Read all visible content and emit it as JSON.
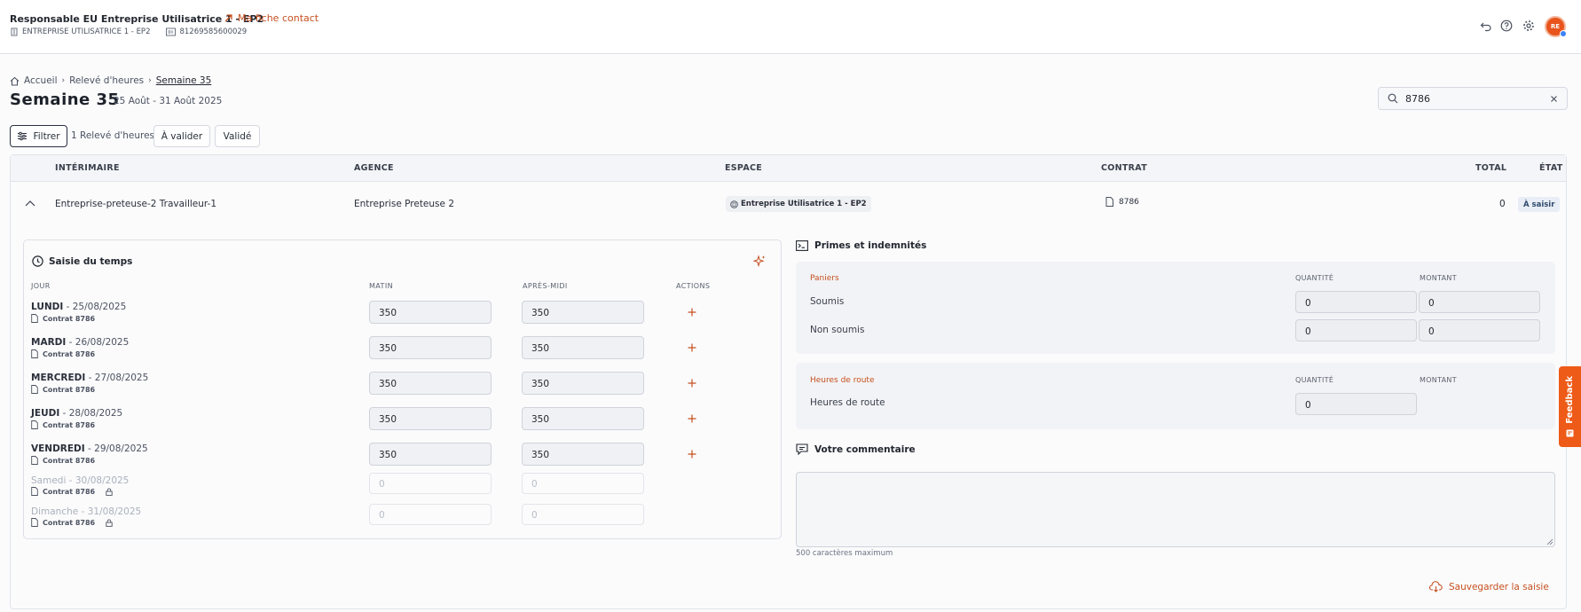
{
  "header": {
    "user_title": "Responsable EU Entreprise Utilisatrice 1 - EP2",
    "contact_link": "Ma fiche contact",
    "company_name": "ENTREPRISE UTILISATRICE 1 - EP2",
    "siret": "81269585600029",
    "avatar_initials": "RE"
  },
  "breadcrumb": {
    "home": "Accueil",
    "releve": "Relevé d'heures",
    "current": "Semaine 35"
  },
  "page": {
    "title": "Semaine 35",
    "dates": "25 Août - 31 Août 2025"
  },
  "search": {
    "value": "8786"
  },
  "toolbar": {
    "filter_label": "Filtrer",
    "count_label": "1 Relevé d'heures",
    "a_valider": "À valider",
    "valide": "Validé"
  },
  "table": {
    "columns": [
      "INTÉRIMAIRE",
      "AGENCE",
      "ESPACE",
      "CONTRAT",
      "TOTAL",
      "ÉTAT"
    ],
    "row": {
      "interimaire": "Entreprise-preteuse-2 Travailleur-1",
      "agence": "Entreprise Preteuse 2",
      "espace": "Entreprise Utilisatrice 1 - EP2",
      "contrat": "8786",
      "total": "0",
      "etat": "À saisir"
    }
  },
  "saisie": {
    "title": "Saisie du temps",
    "columns": [
      "JOUR",
      "MATIN",
      "APRÈS-MIDI",
      "ACTIONS"
    ],
    "days": [
      {
        "name": "LUNDI",
        "date": "25/08/2025",
        "contract": "Contrat 8786",
        "matin": "350",
        "apres_midi": "350",
        "locked": false
      },
      {
        "name": "MARDI",
        "date": "26/08/2025",
        "contract": "Contrat 8786",
        "matin": "350",
        "apres_midi": "350",
        "locked": false
      },
      {
        "name": "MERCREDI",
        "date": "27/08/2025",
        "contract": "Contrat 8786",
        "matin": "350",
        "apres_midi": "350",
        "locked": false
      },
      {
        "name": "JEUDI",
        "date": "28/08/2025",
        "contract": "Contrat 8786",
        "matin": "350",
        "apres_midi": "350",
        "locked": false
      },
      {
        "name": "VENDREDI",
        "date": "29/08/2025",
        "contract": "Contrat 8786",
        "matin": "350",
        "apres_midi": "350",
        "locked": false
      },
      {
        "name": "Samedi",
        "date": "30/08/2025",
        "contract": "Contrat 8786",
        "matin": "0",
        "apres_midi": "0",
        "locked": true
      },
      {
        "name": "Dimanche",
        "date": "31/08/2025",
        "contract": "Contrat 8786",
        "matin": "0",
        "apres_midi": "0",
        "locked": true
      }
    ],
    "separator": " - "
  },
  "primes": {
    "title": "Primes et indemnités",
    "paniers": {
      "label": "Paniers",
      "col_quantite": "QUANTITÉ",
      "col_montant": "MONTANT",
      "rows": [
        {
          "label": "Soumis",
          "quantite": "0",
          "montant": "0"
        },
        {
          "label": "Non soumis",
          "quantite": "0",
          "montant": "0"
        }
      ]
    },
    "heures_route": {
      "label": "Heures de route",
      "col_quantite": "QUANTITÉ",
      "col_montant": "MONTANT",
      "row_label": "Heures de route",
      "quantite": "0"
    }
  },
  "comment": {
    "title": "Votre commentaire",
    "value": "",
    "max_label": "500 caractères maximum"
  },
  "save_label": "Sauvegarder la saisie",
  "feedback_label": "Feedback",
  "colors": {
    "accent": "#c6501f",
    "feedback": "#ee5a17",
    "avatar": "#e8541c"
  }
}
